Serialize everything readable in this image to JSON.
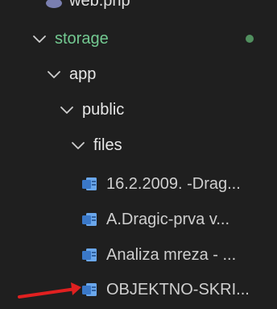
{
  "explorer": {
    "top_item": {
      "label": "web.php"
    },
    "storage": {
      "label": "storage",
      "status": "modified-dot"
    },
    "app": {
      "label": "app"
    },
    "public": {
      "label": "public"
    },
    "files": {
      "label": "files"
    },
    "file_items": [
      {
        "label": "16.2.2009. -Drag..."
      },
      {
        "label": "A.Dragic-prva v..."
      },
      {
        "label": "Analiza mreza - ..."
      },
      {
        "label": "OBJEKTNO-SKRI..."
      }
    ]
  },
  "colors": {
    "background": "#1f1f1f",
    "storage_text": "#73c991",
    "git_dot": "#5aa56b",
    "word_icon": "#4f8fd8",
    "annotation_arrow": "#e02020"
  },
  "icons": {
    "chevron": "chevron-down-icon",
    "file": "word-document-icon",
    "annotation": "red-arrow-annotation"
  }
}
